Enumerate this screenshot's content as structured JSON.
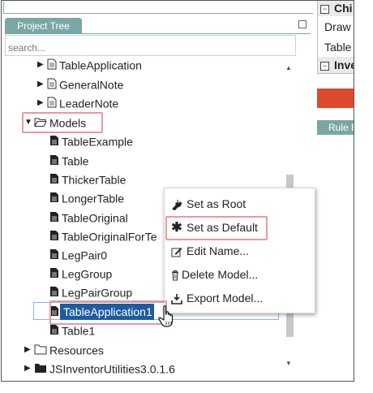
{
  "panel": {
    "tab_label": "Project Tree",
    "search_placeholder": "search..."
  },
  "tree": {
    "nodes": [
      {
        "label": "TableApplication",
        "icon": "document-icon",
        "expand": "collapsed"
      },
      {
        "label": "GeneralNote",
        "icon": "document-icon",
        "expand": "collapsed"
      },
      {
        "label": "LeaderNote",
        "icon": "document-icon",
        "expand": "collapsed"
      },
      {
        "label": "Models",
        "icon": "folder-open-icon",
        "expand": "expanded"
      },
      {
        "label": "TableExample",
        "icon": "model-file-icon"
      },
      {
        "label": "Table",
        "icon": "model-file-icon"
      },
      {
        "label": "ThickerTable",
        "icon": "model-file-icon"
      },
      {
        "label": "LongerTable",
        "icon": "model-file-icon"
      },
      {
        "label": "TableOriginal",
        "icon": "model-file-icon"
      },
      {
        "label": "TableOriginalForTe",
        "icon": "model-file-icon"
      },
      {
        "label": "LegPair0",
        "icon": "model-file-icon"
      },
      {
        "label": "LegGroup",
        "icon": "model-file-icon"
      },
      {
        "label": "LegPairGroup",
        "icon": "model-file-icon"
      },
      {
        "label": "TableApplication1",
        "icon": "model-file-icon",
        "selected": true
      },
      {
        "label": "Table1",
        "icon": "model-file-icon"
      },
      {
        "label": "Resources",
        "icon": "folder-icon",
        "expand": "collapsed"
      },
      {
        "label": "JSInventorUtilities3.0.1.6",
        "icon": "folder-filled-icon",
        "expand": "collapsed"
      }
    ]
  },
  "context_menu": {
    "items": [
      {
        "label": "Set as Root",
        "icon": "plug-icon"
      },
      {
        "label": "Set as Default",
        "icon": "asterisk-icon"
      },
      {
        "label": "Edit Name...",
        "icon": "edit-icon"
      },
      {
        "label": "Delete Model...",
        "icon": "trash-icon"
      },
      {
        "label": "Export Model...",
        "icon": "export-icon"
      }
    ]
  },
  "right_panel": {
    "child_header": "Chi",
    "rows": [
      "Draw",
      "Table"
    ],
    "inventor_header": "Inve",
    "rule_header": "Rule E"
  },
  "colors": {
    "tab": "#7aa7a5",
    "selection": "#1f5b9e",
    "highlight": "#e89a9a",
    "orange_button": "#de4a2c"
  }
}
